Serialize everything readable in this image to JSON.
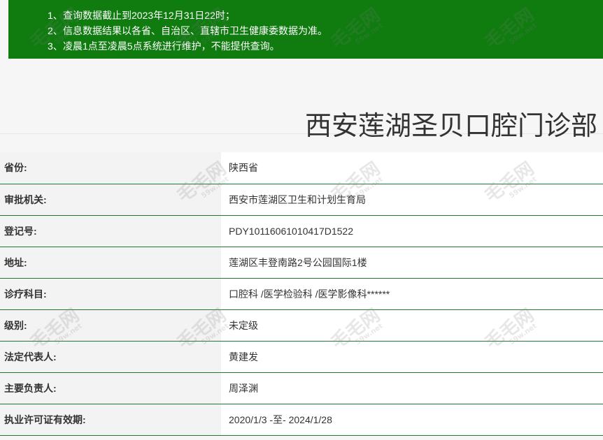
{
  "notice": {
    "lines": [
      {
        "num": "1、",
        "text": "查询数据截止到2023年12月31日22时；"
      },
      {
        "num": "2、",
        "text": "信息数据结果以各省、自治区、直辖市卫生健康委数据为准。"
      },
      {
        "num": "3、",
        "text": "凌晨1点至凌晨5点系统进行维护，不能提供查询。"
      }
    ]
  },
  "page_title": "西安莲湖圣贝口腔门诊部",
  "rows": [
    {
      "label": "省份:",
      "value": "陕西省"
    },
    {
      "label": "审批机关:",
      "value": "西安市莲湖区卫生和计划生育局"
    },
    {
      "label": "登记号:",
      "value": "PDY10116061010417D1522"
    },
    {
      "label": "地址:",
      "value": "莲湖区丰登南路2号公园国际1楼"
    },
    {
      "label": "诊疗科目:",
      "value": "口腔科 /医学检验科 /医学影像科******"
    },
    {
      "label": "级别:",
      "value": "未定级"
    },
    {
      "label": "法定代表人:",
      "value": "黄建发"
    },
    {
      "label": "主要负责人:",
      "value": "周泽渊"
    },
    {
      "label": "执业许可证有效期:",
      "value": "2020/1/3 -至- 2024/1/28"
    }
  ],
  "watermark": {
    "text": "毛毛网",
    "sub": "59w.net"
  }
}
